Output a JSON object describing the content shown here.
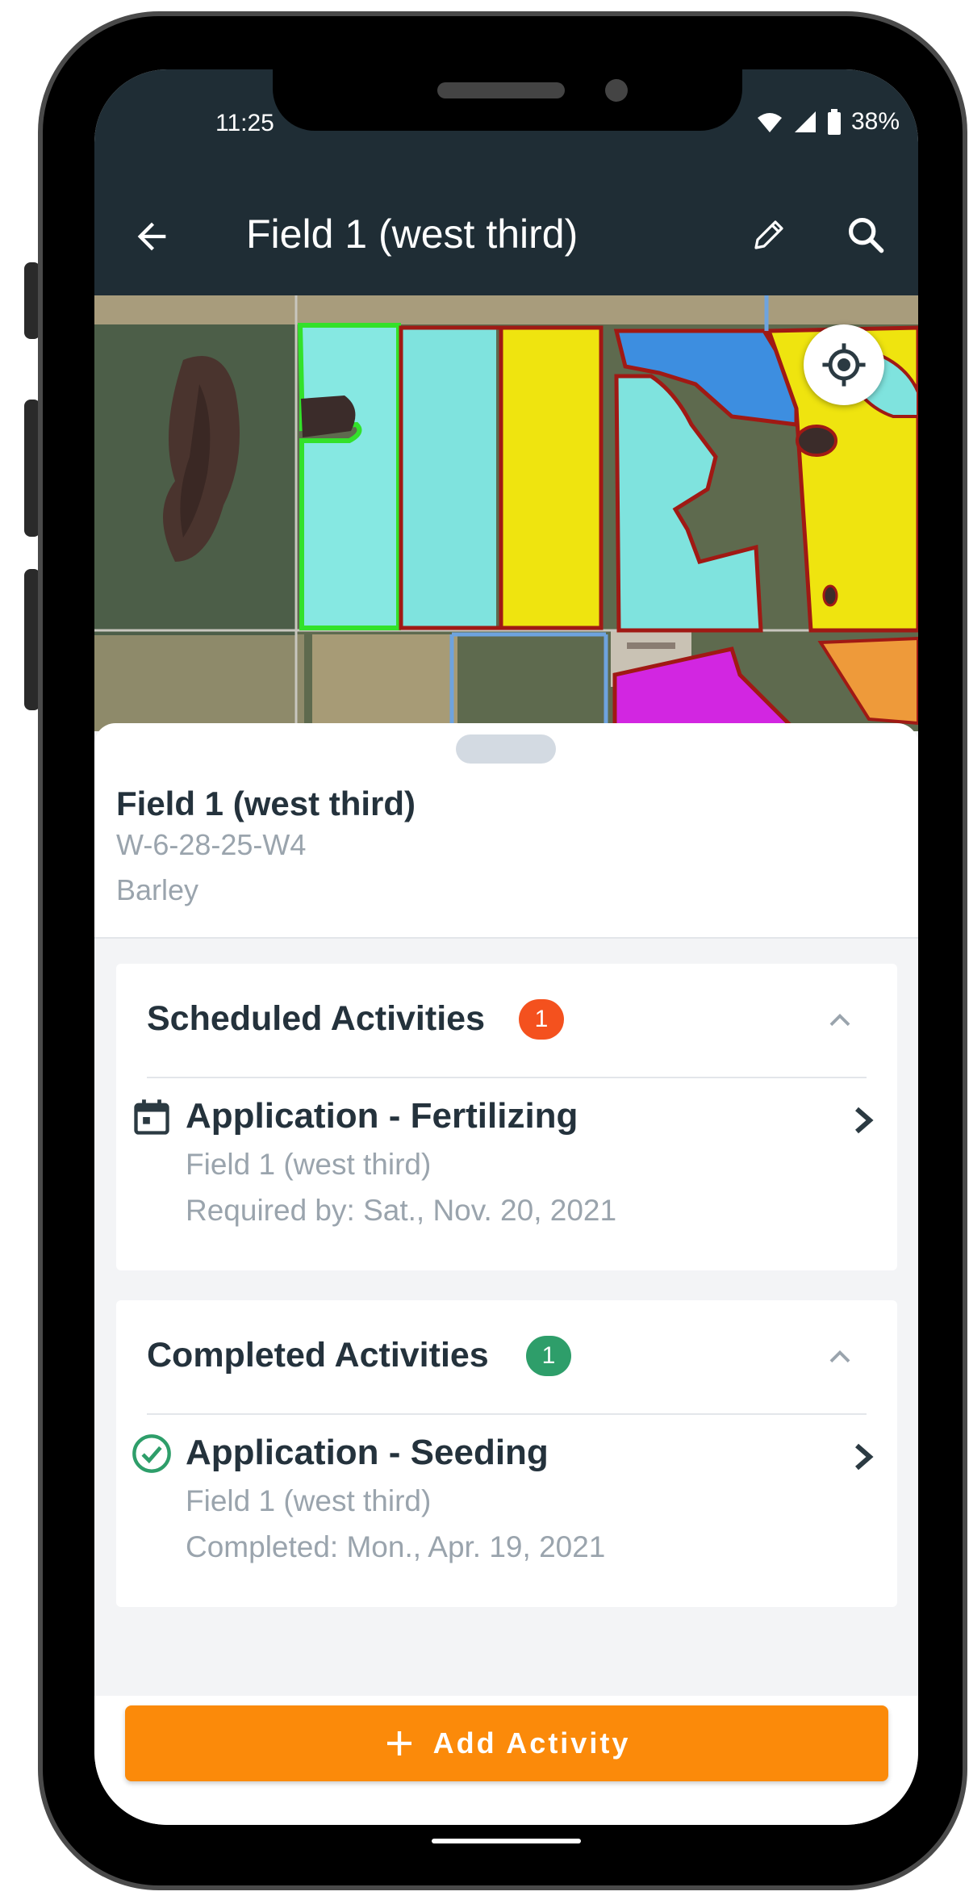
{
  "status": {
    "time": "11:25",
    "battery": "38%"
  },
  "appbar": {
    "title": "Field 1 (west third)"
  },
  "field": {
    "name": "Field 1 (west third)",
    "legal": "W-6-28-25-W4",
    "crop": "Barley"
  },
  "scheduled": {
    "title": "Scheduled Activities",
    "count": "1",
    "badge_color": "#f4511e",
    "item": {
      "title": "Application - Fertilizing",
      "field": "Field 1 (west third)",
      "date": "Required by: Sat., Nov. 20, 2021"
    }
  },
  "completed": {
    "title": "Completed Activities",
    "count": "1",
    "badge_color": "#2e9e6a",
    "item": {
      "title": "Application - Seeding",
      "field": "Field 1 (west third)",
      "date": "Completed: Mon., Apr. 19, 2021"
    }
  },
  "actions": {
    "add_activity": "Add Activity"
  },
  "colors": {
    "accent": "#fb8a0a",
    "appbar": "#1f2d35"
  }
}
